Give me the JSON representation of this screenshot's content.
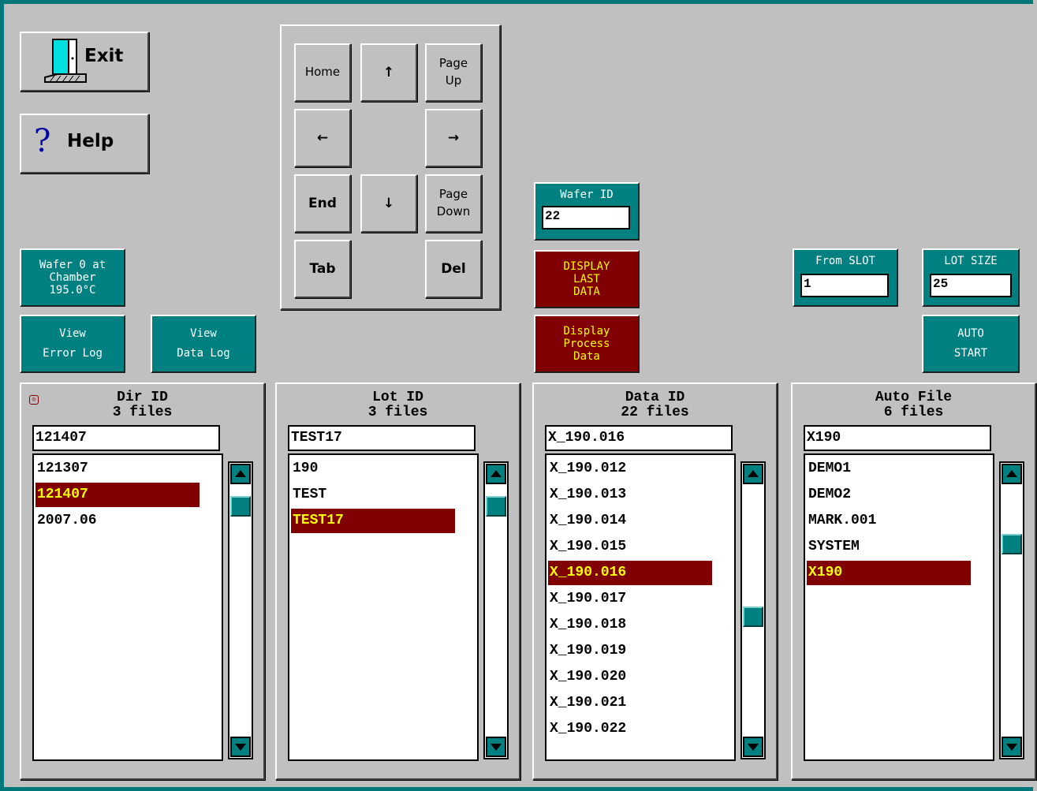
{
  "exit_label": "Exit",
  "help_label": "Help",
  "keypad": {
    "home": "Home",
    "up": "↑",
    "page_up": [
      "Page",
      "Up"
    ],
    "left": "←",
    "right": "→",
    "end": "End",
    "down": "↓",
    "page_down": [
      "Page",
      "Down"
    ],
    "tab": "Tab",
    "del": "Del"
  },
  "status": {
    "wafer_chamber": [
      "Wafer 0 at",
      "Chamber",
      "195.0°C"
    ]
  },
  "view_error_log": [
    "View",
    "Error Log"
  ],
  "view_data_log": [
    "View",
    "Data Log"
  ],
  "wafer_id": {
    "label": "Wafer ID",
    "value": "22"
  },
  "display_last_data": [
    "DISPLAY",
    "LAST",
    "DATA"
  ],
  "display_process_data": [
    "Display",
    "Process",
    "Data"
  ],
  "from_slot": {
    "label": "From SLOT",
    "value": "1"
  },
  "lot_size": {
    "label": "LOT SIZE",
    "value": "25"
  },
  "auto_start": [
    "AUTO",
    "START"
  ],
  "panels": {
    "dir": {
      "title": [
        "Dir ID",
        "3 files"
      ],
      "value": "121407",
      "items": [
        "121307",
        "121407",
        "2007.06"
      ],
      "selected_index": 1
    },
    "lot": {
      "title": [
        "Lot ID",
        "3 files"
      ],
      "value": "TEST17",
      "items": [
        "190",
        "TEST",
        "TEST17"
      ],
      "selected_index": 2
    },
    "data": {
      "title": [
        "Data ID",
        "22 files"
      ],
      "value": "X_190.016",
      "items": [
        "X_190.012",
        "X_190.013",
        "X_190.014",
        "X_190.015",
        "X_190.016",
        "X_190.017",
        "X_190.018",
        "X_190.019",
        "X_190.020",
        "X_190.021",
        "X_190.022"
      ],
      "selected_index": 4
    },
    "auto": {
      "title": [
        "Auto File",
        "6 files"
      ],
      "value": "X190",
      "items": [
        "DEMO1",
        "DEMO2",
        "MARK.001",
        "SYSTEM",
        "X190"
      ],
      "selected_index": 4
    }
  },
  "colors": {
    "background": "#c0c0c0",
    "teal": "#008080",
    "maroon": "#800000",
    "selected_text": "#ffff00",
    "frame": "#00787a"
  },
  "icons": [
    "door-exit-icon",
    "question-mark-icon",
    "smiley-icon"
  ]
}
